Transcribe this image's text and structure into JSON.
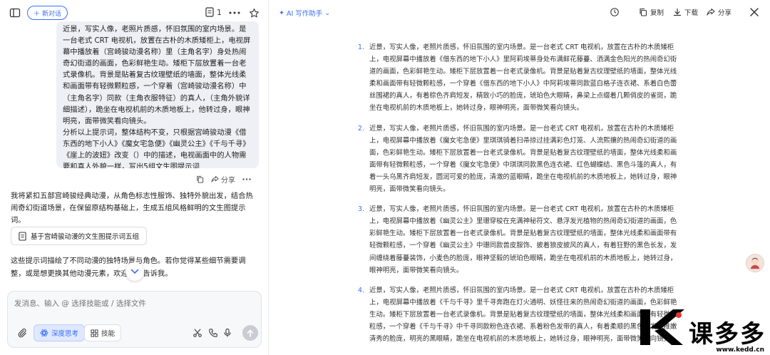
{
  "left": {
    "new_chat_label": "新对话",
    "doc_count": "1",
    "user_message": [
      "近景，写实人像，老照片质感，怀旧氛围的室内场景。是一台老式 CRT 电视机，放置在古朴的木质矮柜上，电视屏幕中播放着（宫崎骏动漫名称）里（主角名字）身处热闹奇幻街道的画面，色彩鲜艳生动。矮柜下层放置着一台老式录像机。背景是贴着复古纹理壁纸的墙面，整体光线柔和画面带有轻微颗粒感，一个穿着（宫崎骏动漫名称）中（主角名字）同款（主角衣服特征）的真人，（主角外貌详细描述），跪坐在电视机前的木质地板上，他转过身，眼神明亮，面带微笑看向镜头。",
      "分析以上提示词，整体结构不变，只根据宫崎骏动漫《借东西的地下小人》《魔女宅急便》《幽灵公主》《千与千寻》《崖上的波妞》改变（）中的描述，电视画面中的人物需要和真人外貌一样，写出5组文生图提示词"
    ],
    "actions": {
      "copy": "",
      "share": "分享"
    },
    "reply_1": "我将紧扣五部宫崎骏经典动漫，从角色标志性服饰、独特外貌出发，结合热闹奇幻街道场景，在保留原结构基础上，生成五组风格鲜明的文生图提示词。",
    "ref_card": "基于宫崎骏动漫的文生图提示词五组",
    "reply_2": "这些提示词描绘了不同动漫的独特场景与角色。若你觉得某些细节需要调整，或是想更换其他动漫元素，欢迎随时告诉我。",
    "composer": {
      "placeholder": "发消息、输入 @ 选择技能或 / 选择文件",
      "deep_think": "深度思考",
      "skills": "技能"
    }
  },
  "right": {
    "ai_label": "AI 写作助手",
    "copy": "复制",
    "download": "下载",
    "share": "分享",
    "items": [
      {
        "num": "1.",
        "text": "近景，写实人像，老照片质感，怀旧氛围的室内场景。是一台老式 CRT 电视机，放置在古朴的木质矮柜上，电视屏幕中播放着《借东西的地下小人》里阿莉埃蒂身处布满鲜花藤蔓、洒满金色阳光的热闹奇幻街道的画面，色彩鲜艳生动。矮柜下层放置着一台老式录像机。背景是贴着复古纹理壁纸的墙面，整体光线柔和画面带有轻微颗粒感，一个穿着《借东西的地下小人》中阿莉埃蒂同款蓝白格子连衣裙、系着白色蕾丝围裙的真人，有着棕色齐肩短发，精致小巧的脸庞，琥珀色大眼睛，鼻梁上点缀着几颗俏皮的雀斑，跪坐在电视机前的木质地板上，她转过身，眼神明亮，面带微笑看向镜头。"
      },
      {
        "num": "2.",
        "text": "近景，写实人像，老照片质感，怀旧氛围的室内场景。是一台老式 CRT 电视机，放置在古朴的木质矮柜上，电视屏幕中播放着《魔女宅急便》里琪琪骑着扫帚掠过挂满彩色灯笼、人流熙攘的热闹奇幻街道的画面，色彩鲜艳生动。矮柜下层放置着一台老式录像机。背景是贴着复古纹理壁纸的墙面，整体光线柔和画面带有轻微颗粒感，一个穿着《魔女宅急便》中琪琪同款黑色连衣裙、红色蝴蝶结、黑色斗篷的真人，有着一头乌黑齐肩短发，圆润可爱的脸庞，清澈的蓝眼睛，跪坐在电视机前的木质地板上，她转过身，眼神明亮，面带微笑看向镜头。"
      },
      {
        "num": "3.",
        "text": "近景，写实人像，老照片质感，怀旧氛围的室内场景。是一台老式 CRT 电视机，放置在古朴的木质矮柜上，电视屏幕中播放着《幽灵公主》里珊穿梭在充满神秘符文、悬浮发光植物的热闹奇幻街道的画面，色彩鲜艳生动。矮柜下层放置着一台老式录像机。背景是贴着复古纹理壁纸的墙面，整体光线柔和画面带有轻微颗粒感，一个穿着《幽灵公主》中珊同款兽皮服饰、披着狼皮披风的真人，有着狂野的黑色长发，发间缠绕着藤蔓装饰，小麦色的脸庞，眼神坚毅的琥珀色眼睛，跪坐在电视机前的木质地板上，她转过身，眼神明亮，面带微笑看向镜头。"
      },
      {
        "num": "4.",
        "text": "近景，写实人像，老照片质感，怀旧氛围的室内场景。是一台老式 CRT 电视机，放置在古朴的木质矮柜上，电视屏幕中播放着《千与千寻》里千寻奔跑在灯火通明、妖怪往来的热闹奇幻街道的画面，色彩鲜艳生动。矮柜下层放置着一台老式录像机。背景是贴着复古纹理壁纸的墙面，整体光线柔和画面带有轻微颗粒感，一个穿着《千与千寻》中千寻同款粉色连衣裙、系着粉色发带的真人，有着柔顺的黑色短发，稚嫩清秀的脸庞，明亮的黑眼睛，跪坐在电视机前的木质地板上，她转过身，眼神明亮，面带微笑看向镜头。"
      }
    ]
  },
  "watermark": {
    "brand": "课多多",
    "url": "www.kedd.cn"
  }
}
